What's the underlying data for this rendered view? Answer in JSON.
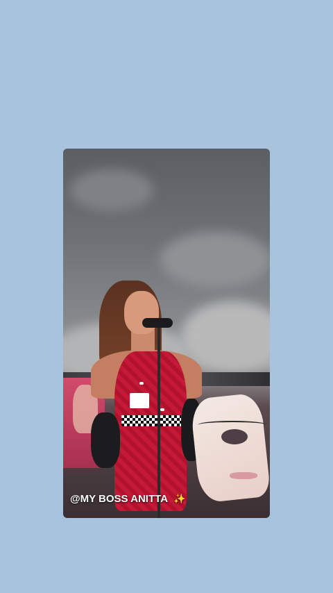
{
  "story": {
    "caption": "@MY BOSS ANITTA",
    "sparkle_emoji": "✨",
    "media_subject": "singer-performing-on-stage-photo"
  },
  "colors": {
    "background": "#a8c3dd",
    "caption_text": "#ffffff",
    "sparkle": "#ffd84a"
  },
  "icons": {
    "sparkle": "sparkles-icon"
  }
}
